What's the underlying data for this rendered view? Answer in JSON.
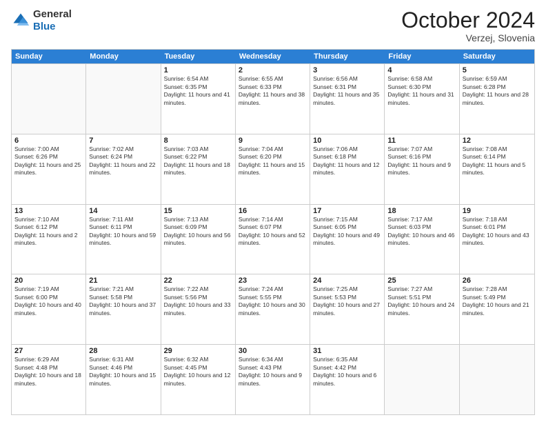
{
  "header": {
    "logo_general": "General",
    "logo_blue": "Blue",
    "month_title": "October 2024",
    "location": "Verzej, Slovenia"
  },
  "days_of_week": [
    "Sunday",
    "Monday",
    "Tuesday",
    "Wednesday",
    "Thursday",
    "Friday",
    "Saturday"
  ],
  "weeks": [
    [
      {
        "day": "",
        "sunrise": "",
        "sunset": "",
        "daylight": "",
        "empty": true
      },
      {
        "day": "",
        "sunrise": "",
        "sunset": "",
        "daylight": "",
        "empty": true
      },
      {
        "day": "1",
        "sunrise": "Sunrise: 6:54 AM",
        "sunset": "Sunset: 6:35 PM",
        "daylight": "Daylight: 11 hours and 41 minutes.",
        "empty": false
      },
      {
        "day": "2",
        "sunrise": "Sunrise: 6:55 AM",
        "sunset": "Sunset: 6:33 PM",
        "daylight": "Daylight: 11 hours and 38 minutes.",
        "empty": false
      },
      {
        "day": "3",
        "sunrise": "Sunrise: 6:56 AM",
        "sunset": "Sunset: 6:31 PM",
        "daylight": "Daylight: 11 hours and 35 minutes.",
        "empty": false
      },
      {
        "day": "4",
        "sunrise": "Sunrise: 6:58 AM",
        "sunset": "Sunset: 6:30 PM",
        "daylight": "Daylight: 11 hours and 31 minutes.",
        "empty": false
      },
      {
        "day": "5",
        "sunrise": "Sunrise: 6:59 AM",
        "sunset": "Sunset: 6:28 PM",
        "daylight": "Daylight: 11 hours and 28 minutes.",
        "empty": false
      }
    ],
    [
      {
        "day": "6",
        "sunrise": "Sunrise: 7:00 AM",
        "sunset": "Sunset: 6:26 PM",
        "daylight": "Daylight: 11 hours and 25 minutes.",
        "empty": false
      },
      {
        "day": "7",
        "sunrise": "Sunrise: 7:02 AM",
        "sunset": "Sunset: 6:24 PM",
        "daylight": "Daylight: 11 hours and 22 minutes.",
        "empty": false
      },
      {
        "day": "8",
        "sunrise": "Sunrise: 7:03 AM",
        "sunset": "Sunset: 6:22 PM",
        "daylight": "Daylight: 11 hours and 18 minutes.",
        "empty": false
      },
      {
        "day": "9",
        "sunrise": "Sunrise: 7:04 AM",
        "sunset": "Sunset: 6:20 PM",
        "daylight": "Daylight: 11 hours and 15 minutes.",
        "empty": false
      },
      {
        "day": "10",
        "sunrise": "Sunrise: 7:06 AM",
        "sunset": "Sunset: 6:18 PM",
        "daylight": "Daylight: 11 hours and 12 minutes.",
        "empty": false
      },
      {
        "day": "11",
        "sunrise": "Sunrise: 7:07 AM",
        "sunset": "Sunset: 6:16 PM",
        "daylight": "Daylight: 11 hours and 9 minutes.",
        "empty": false
      },
      {
        "day": "12",
        "sunrise": "Sunrise: 7:08 AM",
        "sunset": "Sunset: 6:14 PM",
        "daylight": "Daylight: 11 hours and 5 minutes.",
        "empty": false
      }
    ],
    [
      {
        "day": "13",
        "sunrise": "Sunrise: 7:10 AM",
        "sunset": "Sunset: 6:12 PM",
        "daylight": "Daylight: 11 hours and 2 minutes.",
        "empty": false
      },
      {
        "day": "14",
        "sunrise": "Sunrise: 7:11 AM",
        "sunset": "Sunset: 6:11 PM",
        "daylight": "Daylight: 10 hours and 59 minutes.",
        "empty": false
      },
      {
        "day": "15",
        "sunrise": "Sunrise: 7:13 AM",
        "sunset": "Sunset: 6:09 PM",
        "daylight": "Daylight: 10 hours and 56 minutes.",
        "empty": false
      },
      {
        "day": "16",
        "sunrise": "Sunrise: 7:14 AM",
        "sunset": "Sunset: 6:07 PM",
        "daylight": "Daylight: 10 hours and 52 minutes.",
        "empty": false
      },
      {
        "day": "17",
        "sunrise": "Sunrise: 7:15 AM",
        "sunset": "Sunset: 6:05 PM",
        "daylight": "Daylight: 10 hours and 49 minutes.",
        "empty": false
      },
      {
        "day": "18",
        "sunrise": "Sunrise: 7:17 AM",
        "sunset": "Sunset: 6:03 PM",
        "daylight": "Daylight: 10 hours and 46 minutes.",
        "empty": false
      },
      {
        "day": "19",
        "sunrise": "Sunrise: 7:18 AM",
        "sunset": "Sunset: 6:01 PM",
        "daylight": "Daylight: 10 hours and 43 minutes.",
        "empty": false
      }
    ],
    [
      {
        "day": "20",
        "sunrise": "Sunrise: 7:19 AM",
        "sunset": "Sunset: 6:00 PM",
        "daylight": "Daylight: 10 hours and 40 minutes.",
        "empty": false
      },
      {
        "day": "21",
        "sunrise": "Sunrise: 7:21 AM",
        "sunset": "Sunset: 5:58 PM",
        "daylight": "Daylight: 10 hours and 37 minutes.",
        "empty": false
      },
      {
        "day": "22",
        "sunrise": "Sunrise: 7:22 AM",
        "sunset": "Sunset: 5:56 PM",
        "daylight": "Daylight: 10 hours and 33 minutes.",
        "empty": false
      },
      {
        "day": "23",
        "sunrise": "Sunrise: 7:24 AM",
        "sunset": "Sunset: 5:55 PM",
        "daylight": "Daylight: 10 hours and 30 minutes.",
        "empty": false
      },
      {
        "day": "24",
        "sunrise": "Sunrise: 7:25 AM",
        "sunset": "Sunset: 5:53 PM",
        "daylight": "Daylight: 10 hours and 27 minutes.",
        "empty": false
      },
      {
        "day": "25",
        "sunrise": "Sunrise: 7:27 AM",
        "sunset": "Sunset: 5:51 PM",
        "daylight": "Daylight: 10 hours and 24 minutes.",
        "empty": false
      },
      {
        "day": "26",
        "sunrise": "Sunrise: 7:28 AM",
        "sunset": "Sunset: 5:49 PM",
        "daylight": "Daylight: 10 hours and 21 minutes.",
        "empty": false
      }
    ],
    [
      {
        "day": "27",
        "sunrise": "Sunrise: 6:29 AM",
        "sunset": "Sunset: 4:48 PM",
        "daylight": "Daylight: 10 hours and 18 minutes.",
        "empty": false
      },
      {
        "day": "28",
        "sunrise": "Sunrise: 6:31 AM",
        "sunset": "Sunset: 4:46 PM",
        "daylight": "Daylight: 10 hours and 15 minutes.",
        "empty": false
      },
      {
        "day": "29",
        "sunrise": "Sunrise: 6:32 AM",
        "sunset": "Sunset: 4:45 PM",
        "daylight": "Daylight: 10 hours and 12 minutes.",
        "empty": false
      },
      {
        "day": "30",
        "sunrise": "Sunrise: 6:34 AM",
        "sunset": "Sunset: 4:43 PM",
        "daylight": "Daylight: 10 hours and 9 minutes.",
        "empty": false
      },
      {
        "day": "31",
        "sunrise": "Sunrise: 6:35 AM",
        "sunset": "Sunset: 4:42 PM",
        "daylight": "Daylight: 10 hours and 6 minutes.",
        "empty": false
      },
      {
        "day": "",
        "sunrise": "",
        "sunset": "",
        "daylight": "",
        "empty": true
      },
      {
        "day": "",
        "sunrise": "",
        "sunset": "",
        "daylight": "",
        "empty": true
      }
    ]
  ]
}
